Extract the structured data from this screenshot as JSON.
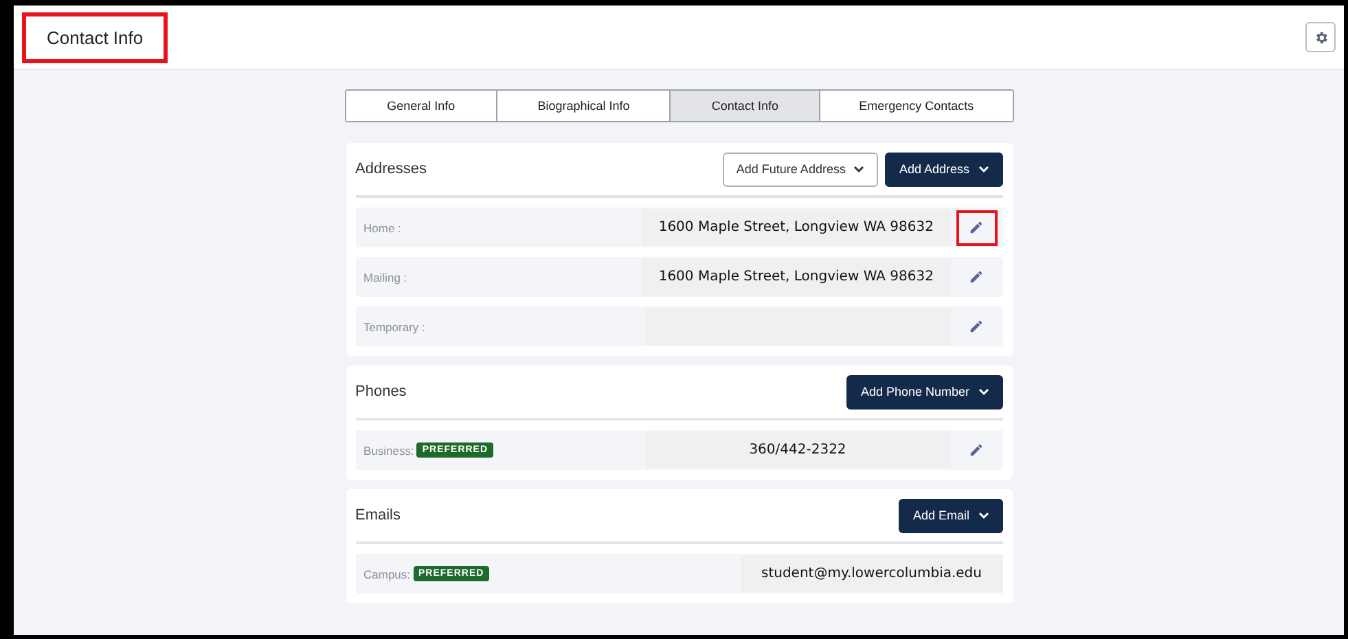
{
  "header": {
    "title": "Contact Info",
    "title_highlighted": true
  },
  "tabs": [
    {
      "label": "General Info",
      "selected": false
    },
    {
      "label": "Biographical Info",
      "selected": false
    },
    {
      "label": "Contact Info",
      "selected": true
    },
    {
      "label": "Emergency Contacts",
      "selected": false
    }
  ],
  "sections": [
    {
      "title": "Addresses",
      "buttons": [
        {
          "label": "Add Future Address",
          "kind": "outline"
        },
        {
          "label": "Add Address",
          "kind": "primary"
        }
      ],
      "rows": [
        {
          "label": "Home :",
          "value": "1600 Maple Street, Longview WA 98632",
          "editable": true,
          "edit_highlighted": true
        },
        {
          "label": "Mailing :",
          "value": "1600 Maple Street, Longview WA 98632",
          "editable": true,
          "edit_highlighted": false
        },
        {
          "label": "Temporary :",
          "editable": true,
          "edit_highlighted": false
        }
      ]
    },
    {
      "title": "Phones",
      "buttons": [
        {
          "label": "Add Phone Number",
          "kind": "primary"
        }
      ],
      "rows": [
        {
          "label": "Business:",
          "badge": "PREFERRED",
          "value": "360/442-2322",
          "editable": true,
          "edit_highlighted": false
        }
      ]
    },
    {
      "title": "Emails",
      "buttons": [
        {
          "label": "Add Email",
          "kind": "primary"
        }
      ],
      "rows": [
        {
          "label": "Campus:",
          "badge": "PREFERRED",
          "value": "student@my.lowercolumbia.edu",
          "editable": false
        }
      ]
    }
  ]
}
